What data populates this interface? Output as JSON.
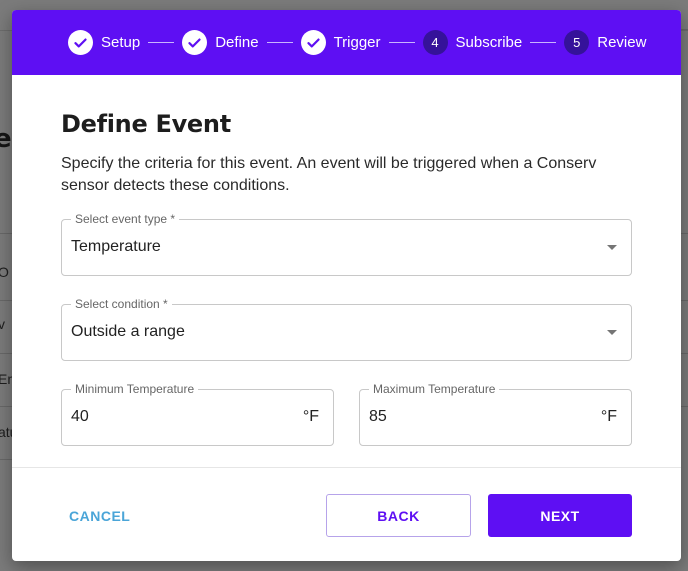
{
  "background": {
    "heading_fragment": "et",
    "rows": [
      "O",
      "v",
      "Em",
      "atu"
    ]
  },
  "stepper": {
    "steps": [
      {
        "label": "Setup",
        "status": "complete",
        "icon": "check-icon"
      },
      {
        "label": "Define",
        "status": "complete",
        "icon": "check-icon"
      },
      {
        "label": "Trigger",
        "status": "complete",
        "icon": "check-icon"
      },
      {
        "label": "Subscribe",
        "status": "pending",
        "number": "4"
      },
      {
        "label": "Review",
        "status": "pending",
        "number": "5"
      }
    ]
  },
  "dialog": {
    "title": "Define Event",
    "description": "Specify the criteria for this event. An event will be triggered when a Conserv sensor detects these conditions.",
    "event_type": {
      "label": "Select event type *",
      "value": "Temperature",
      "icon": "dropdown-arrow-icon"
    },
    "condition": {
      "label": "Select condition *",
      "value": "Outside a range",
      "icon": "dropdown-arrow-icon"
    },
    "min_temperature": {
      "label": "Minimum Temperature",
      "value": "40",
      "unit": "°F"
    },
    "max_temperature": {
      "label": "Maximum Temperature",
      "value": "85",
      "unit": "°F"
    }
  },
  "actions": {
    "cancel": "CANCEL",
    "back": "BACK",
    "next": "NEXT"
  },
  "colors": {
    "primary": "#5e0ff3",
    "step_pending": "#35129a",
    "cancel_text": "#4aa5d8",
    "backdrop": "#7a7a7a"
  }
}
